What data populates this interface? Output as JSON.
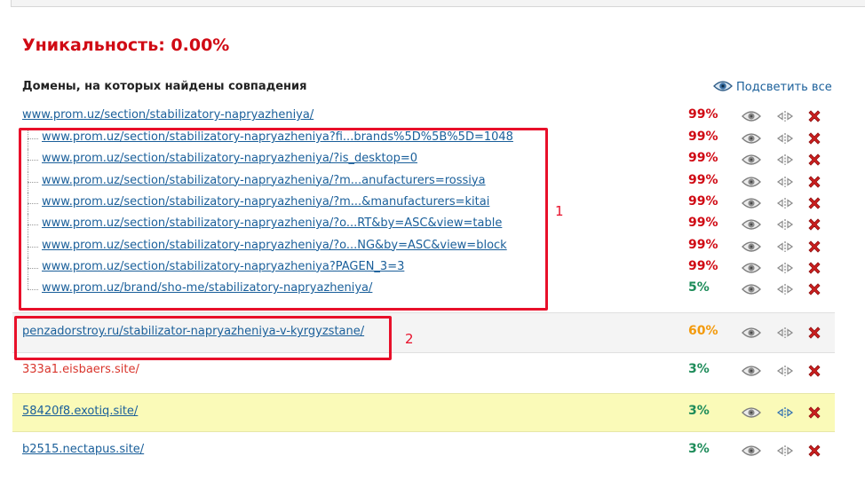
{
  "uniqueness": {
    "label": "Уникальность: 0.00%"
  },
  "domains_header": "Домены, на которых найдены совпадения",
  "highlight_all": {
    "label": "Подсветить все",
    "icon": "eye-icon"
  },
  "colors": {
    "high": "#d00a14",
    "medium": "#f39a0c",
    "low": "#1e8c5a",
    "link": "#1a5f9a",
    "annotation": "#e8102a"
  },
  "groups": [
    {
      "url": "www.prom.uz/section/stabilizatory-napryazheniya/",
      "percent": "99%",
      "percent_level": "high",
      "style": "plain",
      "children": [
        {
          "url": "www.prom.uz/section/stabilizatory-napryazheniya?fi...brands%5D%5B%5D=1048",
          "percent": "99%",
          "percent_level": "high"
        },
        {
          "url": "www.prom.uz/section/stabilizatory-napryazheniya/?is_desktop=0",
          "percent": "99%",
          "percent_level": "high"
        },
        {
          "url": "www.prom.uz/section/stabilizatory-napryazheniya/?m...anufacturers=rossiya",
          "percent": "99%",
          "percent_level": "high"
        },
        {
          "url": "www.prom.uz/section/stabilizatory-napryazheniya/?m...&manufacturers=kitai",
          "percent": "99%",
          "percent_level": "high"
        },
        {
          "url": "www.prom.uz/section/stabilizatory-napryazheniya/?o...RT&by=ASC&view=table",
          "percent": "99%",
          "percent_level": "high"
        },
        {
          "url": "www.prom.uz/section/stabilizatory-napryazheniya/?o...NG&by=ASC&view=block",
          "percent": "99%",
          "percent_level": "high"
        },
        {
          "url": "www.prom.uz/section/stabilizatory-napryazheniya?PAGEN_3=3",
          "percent": "99%",
          "percent_level": "high"
        },
        {
          "url": "www.prom.uz/brand/sho-me/stabilizatory-napryazheniya/",
          "percent": "5%",
          "percent_level": "low"
        }
      ]
    },
    {
      "url": "penzadorstroy.ru/stabilizator-napryazheniya-v-kyrgyzstane/",
      "percent": "60%",
      "percent_level": "medium",
      "style": "bar",
      "children": []
    },
    {
      "url": "333a1.eisbaers.site/",
      "percent": "3%",
      "percent_level": "low",
      "style": "red-text",
      "children": []
    },
    {
      "url": "58420f8.exotiq.site/",
      "percent": "3%",
      "percent_level": "low",
      "style": "highlighted",
      "children": []
    },
    {
      "url": "b2515.nectapus.site/",
      "percent": "3%",
      "percent_level": "low",
      "style": "plain",
      "children": []
    }
  ],
  "row_actions": [
    {
      "name": "view",
      "icon": "eye-icon"
    },
    {
      "name": "compare",
      "icon": "compare-arrows-icon"
    },
    {
      "name": "exclude",
      "icon": "delete-x-icon"
    }
  ],
  "annotations": [
    {
      "label": "1"
    },
    {
      "label": "2"
    }
  ]
}
